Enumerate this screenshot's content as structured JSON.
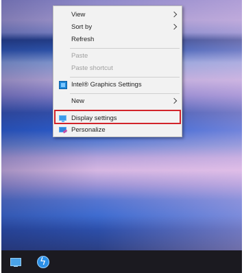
{
  "menu": {
    "items": [
      {
        "label": "View",
        "submenu": true
      },
      {
        "label": "Sort by",
        "submenu": true
      },
      {
        "label": "Refresh"
      },
      {
        "label": "Paste",
        "disabled": true
      },
      {
        "label": "Paste shortcut",
        "disabled": true
      },
      {
        "label": "Intel® Graphics Settings",
        "icon": "intel-graphics-icon"
      },
      {
        "label": "New",
        "submenu": true
      },
      {
        "label": "Display settings",
        "icon": "display-icon",
        "highlighted": true
      },
      {
        "label": "Personalize",
        "icon": "personalize-icon"
      }
    ]
  },
  "taskbar": {
    "icons": [
      "computer-icon",
      "thunderbolt-icon"
    ]
  },
  "colors": {
    "highlight_border": "#d2232a",
    "menu_background": "#f2f2f2",
    "taskbar_background": "#1b1a20"
  }
}
